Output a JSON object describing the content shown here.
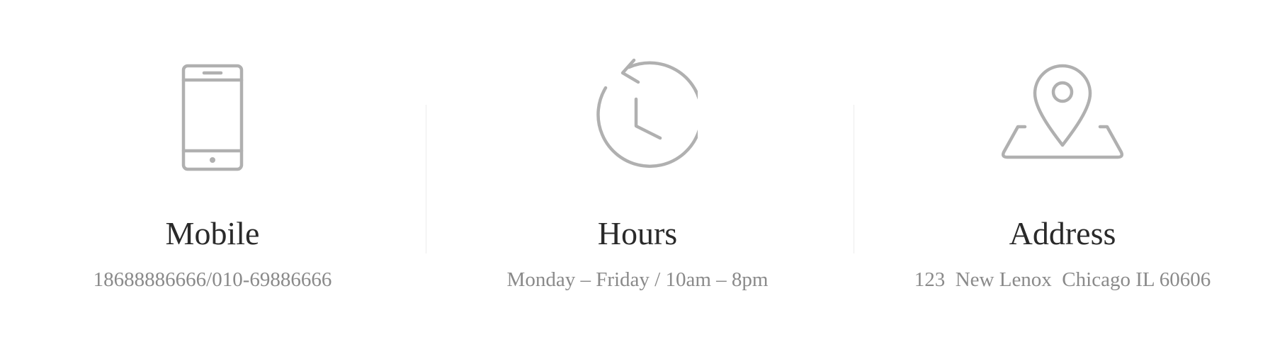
{
  "colors": {
    "icon_stroke": "#b0b0b0",
    "title": "#2a2a2a",
    "detail": "#8a8a8a",
    "divider": "#ececec"
  },
  "items": [
    {
      "icon": "mobile-phone-icon",
      "title": "Mobile",
      "detail": "18688886666/010-69886666"
    },
    {
      "icon": "clock-icon",
      "title": "Hours",
      "detail": "Monday – Friday / 10am – 8pm"
    },
    {
      "icon": "map-pin-icon",
      "title": "Address",
      "detail": "123  New Lenox  Chicago IL 60606"
    }
  ]
}
